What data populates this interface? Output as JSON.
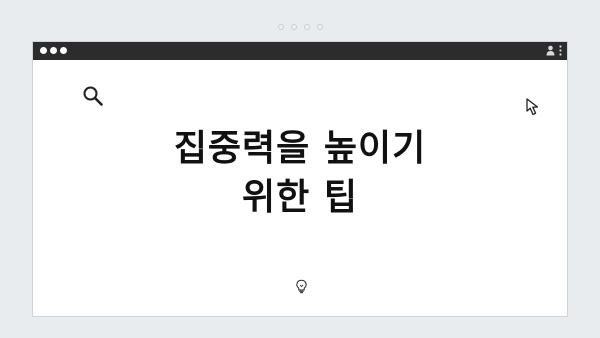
{
  "pager": {
    "dots": [
      1,
      2,
      3,
      4
    ]
  },
  "window": {
    "icons": {
      "traffic_lights": "window-dots",
      "user": "user-icon",
      "menu": "kebab-icon",
      "search": "search-icon",
      "cursor": "cursor-icon",
      "bulb": "lightbulb-icon"
    }
  },
  "headline": {
    "line1": "집중력을 높이기",
    "line2": "위한 팁"
  },
  "colors": {
    "background": "#e9ecef",
    "titlebar": "#2c2c2c",
    "panel": "#ffffff",
    "text": "#111111"
  }
}
